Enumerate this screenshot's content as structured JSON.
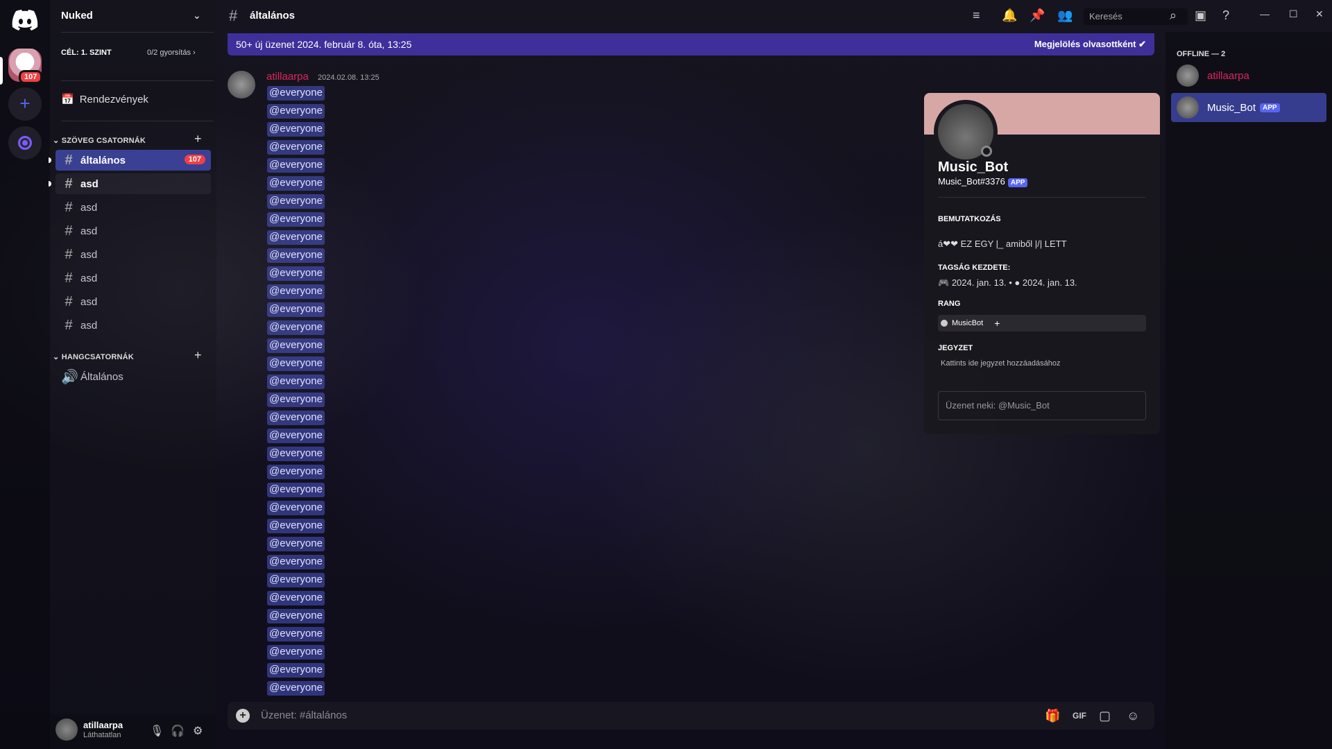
{
  "server": {
    "name": "Nuked",
    "badge": "107",
    "goal": "CÉL: 1. SZINT",
    "boost": "0/2 gyorsítás",
    "events": "Rendezvények"
  },
  "categories": {
    "text": "SZÖVEG CSATORNÁK",
    "voice": "HANGCSATORNÁK"
  },
  "channels": [
    {
      "name": "általános",
      "badge": "107"
    },
    {
      "name": "asd"
    },
    {
      "name": "asd"
    },
    {
      "name": "asd"
    },
    {
      "name": "asd"
    },
    {
      "name": "asd"
    },
    {
      "name": "asd"
    },
    {
      "name": "asd"
    }
  ],
  "voice_channels": [
    {
      "name": "Általános"
    }
  ],
  "user": {
    "name": "atillaarpa",
    "status": "Láthatatlan"
  },
  "topbar": {
    "channel": "általános",
    "search_placeholder": "Keresés"
  },
  "banner": {
    "text": "50+ új üzenet 2024. február 8. óta, 13:25",
    "mark_read": "Megjelölés olvasottként"
  },
  "message": {
    "author": "atillaarpa",
    "timestamp": "2024.02.08. 13:25",
    "mention": "@everyone",
    "mention_count": 34
  },
  "composer": {
    "placeholder": "Üzenet: #általános"
  },
  "profile": {
    "name": "Music_Bot",
    "tag": "Music_Bot#3376",
    "app_badge": "APP",
    "about_title": "BEMUTATKOZÁS",
    "about_text": "á❤❤ EZ EGY |_ amiből |/| LETT",
    "member_since_title": "TAGSÁG KEZDETE:",
    "member_since_discord": "2024. jan. 13.",
    "member_since_server": "2024. jan. 13.",
    "role_title": "RANG",
    "role": "MusicBot",
    "note_title": "JEGYZET",
    "note_placeholder": "Kattints ide jegyzet hozzáadásához",
    "dm_placeholder": "Üzenet neki: @Music_Bot",
    "banner_color": "#d7a7a6"
  },
  "members": {
    "header": "OFFLINE — 2",
    "list": [
      {
        "name": "atillaarpa",
        "color": "#e0245e"
      },
      {
        "name": "Music_Bot",
        "badge": "APP"
      }
    ]
  },
  "colors": {
    "accent": "#5865f2",
    "badge": "#f23f43",
    "author": "#e0245e"
  }
}
